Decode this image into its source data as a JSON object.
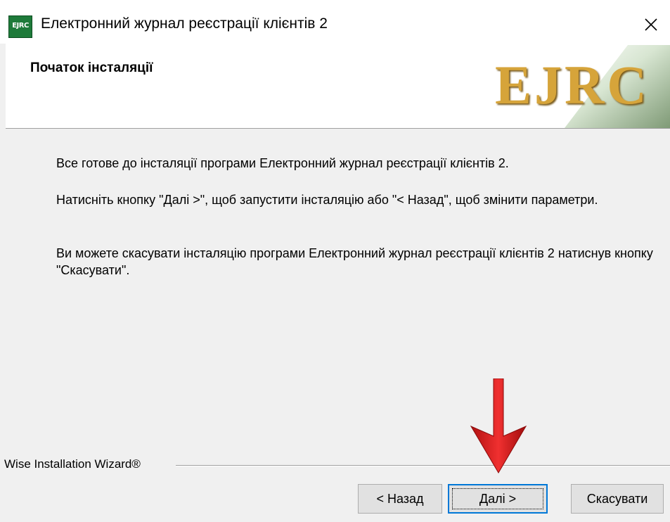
{
  "window": {
    "icon_text": "EJRC",
    "title": "Електронний журнал реєстрації клієнтів 2"
  },
  "header": {
    "title": "Початок інсталяції",
    "logo": "EJRC"
  },
  "body": {
    "paragraphs": [
      "Все готове до інсталяції програми Електронний журнал реєстрації клієнтів 2.",
      "Натисніть кнопку \"Далі >\", щоб запустити інсталяцію або \"< Назад\", щоб змінити параметри.",
      "Ви можете скасувати інсталяцію програми Електронний журнал реєстрації клієнтів 2 натиснув кнопку \"Скасувати\"."
    ]
  },
  "footer": {
    "group_label": "Wise Installation Wizard®",
    "buttons": {
      "back": "< Назад",
      "next": "Далі >",
      "cancel": "Скасувати"
    }
  },
  "icons": {
    "close": "close-icon",
    "arrow": "down-arrow-icon"
  },
  "colors": {
    "logo_gold": "#d6a43a",
    "arrow_red": "#e02020",
    "focus_blue": "#0078d7"
  }
}
